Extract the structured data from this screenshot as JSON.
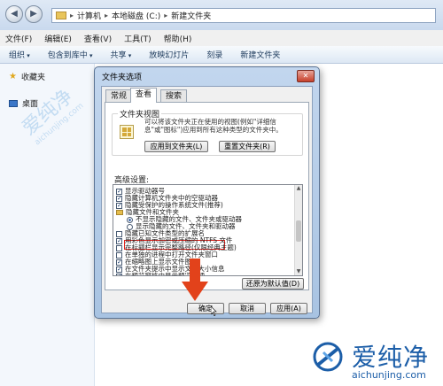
{
  "address": {
    "crumbs": [
      "计算机",
      "本地磁盘 (C:)",
      "新建文件夹"
    ]
  },
  "menu": [
    "文件(F)",
    "编辑(E)",
    "查看(V)",
    "工具(T)",
    "帮助(H)"
  ],
  "toolbar": [
    "组织",
    "包含到库中",
    "共享",
    "放映幻灯片",
    "刻录",
    "新建文件夹"
  ],
  "nav": {
    "favorites": "收藏夹",
    "desktop": "桌面"
  },
  "dialog": {
    "title": "文件夹选项",
    "close": "✕",
    "tabs": [
      "常规",
      "查看",
      "搜索"
    ],
    "active_tab": "查看",
    "folder_view": {
      "legend": "文件夹视图",
      "desc": "可以将该文件夹正在使用的视图(例如\"详细信息\"或\"图标\")应用到所有这种类型的文件夹中。",
      "apply_btn": "应用到文件夹(L)",
      "reset_btn": "重置文件夹(R)"
    },
    "advanced": {
      "label": "高级设置:",
      "rows": [
        {
          "kind": "cb",
          "checked": true,
          "indent": 0,
          "text": "显示驱动器号"
        },
        {
          "kind": "cb",
          "checked": true,
          "indent": 0,
          "text": "隐藏计算机文件夹中的空驱动器"
        },
        {
          "kind": "cb",
          "checked": true,
          "indent": 0,
          "text": "隐藏受保护的操作系统文件(推荐)"
        },
        {
          "kind": "folder",
          "checked": false,
          "indent": 0,
          "text": "隐藏文件和文件夹"
        },
        {
          "kind": "rb",
          "checked": true,
          "indent": 1,
          "text": "不显示隐藏的文件、文件夹或驱动器"
        },
        {
          "kind": "rb",
          "checked": false,
          "indent": 1,
          "text": "显示隐藏的文件、文件夹和驱动器"
        },
        {
          "kind": "cb",
          "checked": false,
          "indent": 0,
          "text": "隐藏已知文件类型的扩展名"
        },
        {
          "kind": "cb",
          "checked": true,
          "indent": 0,
          "text": "用彩色显示加密或压缩的 NTFS 文件"
        },
        {
          "kind": "cb",
          "checked": false,
          "indent": 0,
          "text": "在标题栏显示完整路径(仅限经典主题)"
        },
        {
          "kind": "cb",
          "checked": false,
          "indent": 0,
          "text": "在单独的进程中打开文件夹窗口"
        },
        {
          "kind": "cb",
          "checked": true,
          "indent": 0,
          "text": "在缩略图上显示文件图标"
        },
        {
          "kind": "cb",
          "checked": true,
          "indent": 0,
          "text": "在文件夹提示中显示文件大小信息"
        },
        {
          "kind": "cb",
          "checked": true,
          "indent": 0,
          "text": "在预览窗格中显示预览句柄"
        }
      ],
      "restore_btn": "还原为默认值(D)"
    },
    "footer": {
      "ok": "确定",
      "cancel": "取消",
      "apply": "应用(A)"
    }
  },
  "watermark": {
    "name": "爱纯净",
    "url": "aichunjing.com"
  },
  "colors": {
    "highlight": "#e0231c",
    "arrow": "#e2421b",
    "brand": "#1c5ea8"
  }
}
